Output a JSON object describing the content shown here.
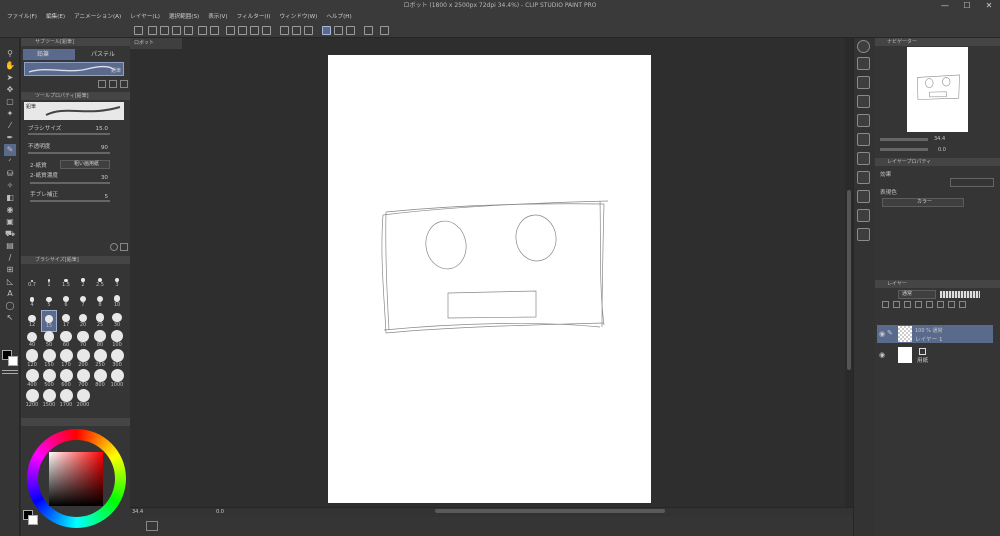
{
  "window": {
    "title": "ロボット (1800 x 2500px 72dpi 34.4%)  - CLIP STUDIO PAINT PRO",
    "min_label": "—",
    "max_label": "☐",
    "close_label": "✕"
  },
  "menu": [
    "ファイル(F)",
    "編集(E)",
    "アニメーション(A)",
    "レイヤー(L)",
    "選択範囲(S)",
    "表示(V)",
    "フィルター(I)",
    "ウィンドウ(W)",
    "ヘルプ(H)"
  ],
  "subtool_panel": {
    "header": "サブツール[鉛筆]",
    "tabs": [
      "鉛筆",
      "パステル"
    ],
    "selected_brush_label": "鉛筆"
  },
  "tool_property": {
    "header": "ツールプロパティ[鉛筆]",
    "brush_name": "鉛筆",
    "brush_size_label": "ブラシサイズ",
    "brush_size_value": "15.0",
    "opacity_label": "不透明度",
    "opacity_value": "90",
    "paper_label": "2-紙質",
    "paper_value": "粗い画用紙",
    "paper_density_label": "2-紙質濃度",
    "paper_density_value": "30",
    "stabilization_label": "手ブレ補正",
    "stabilization_value": "5"
  },
  "brush_size_palette": {
    "header": "ブラシサイズ[鉛筆]",
    "sizes": [
      "0.7",
      "1",
      "1.5",
      "2",
      "2.5",
      "3",
      "4",
      "5",
      "6",
      "7",
      "8",
      "10",
      "12",
      "15",
      "17",
      "20",
      "25",
      "30",
      "40",
      "50",
      "60",
      "70",
      "80",
      "100",
      "120",
      "150",
      "170",
      "200",
      "250",
      "300",
      "400",
      "500",
      "600",
      "700",
      "800",
      "1000",
      "1200",
      "1500",
      "1700",
      "2000"
    ],
    "selected": "15"
  },
  "canvas": {
    "tab_label": "ロボット",
    "zoom_value": "34.4",
    "rotation_value": "0.0"
  },
  "navigator": {
    "header": "ナビゲーター",
    "zoom_value": "34.4",
    "rotation_value": "0.0"
  },
  "layer_property": {
    "header": "レイヤープロパティ",
    "effect_label": "効果",
    "expression_color_label": "表現色",
    "expression_color_value": "カラー"
  },
  "layers": {
    "header": "レイヤー",
    "blend_mode": "通常",
    "opacity_value": "100",
    "items": [
      {
        "name": "レイヤー 1",
        "info": "100 % 通常"
      },
      {
        "name": "用紙",
        "info": ""
      }
    ]
  },
  "colors": {
    "accent": "#5a6a8c",
    "panel": "#353535",
    "canvas_bg": "#2e2e2e"
  }
}
